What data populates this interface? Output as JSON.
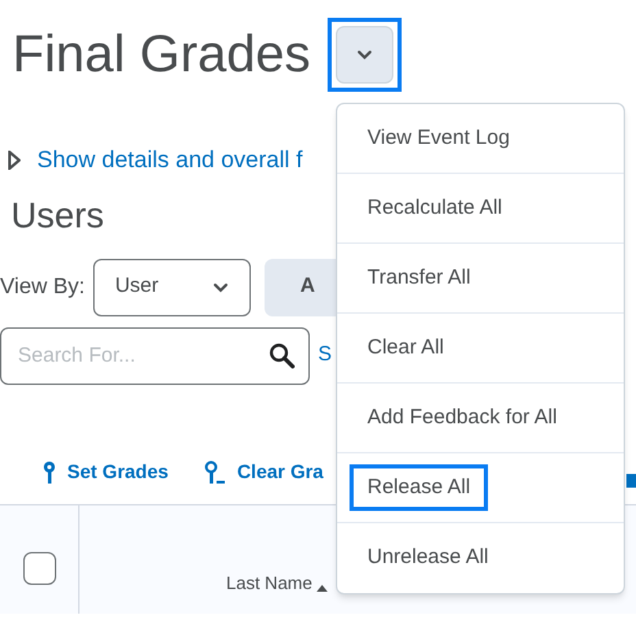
{
  "page_title": "Final Grades",
  "title_menu_button": {
    "highlighted": true
  },
  "details_toggle": {
    "label": "Show details and overall f",
    "expanded": false
  },
  "section_title": "Users",
  "view_by": {
    "label": "View By:",
    "value": "User"
  },
  "apply_button": {
    "label": "A"
  },
  "search": {
    "placeholder": "Search For..."
  },
  "search_options_link": "S",
  "toolbar": [
    {
      "kind": "set",
      "label": "Set Grades"
    },
    {
      "kind": "clear",
      "label": "Clear Gra"
    }
  ],
  "table": {
    "select_all_checked": false,
    "columns": [
      {
        "label": "Last Name",
        "sorted": true
      }
    ]
  },
  "menu": [
    {
      "label": "View Event Log",
      "highlighted": false
    },
    {
      "label": "Recalculate All",
      "highlighted": false
    },
    {
      "label": "Transfer All",
      "highlighted": false
    },
    {
      "label": "Clear All",
      "highlighted": false
    },
    {
      "label": "Add Feedback for All",
      "highlighted": false
    },
    {
      "label": "Release All",
      "highlighted": true
    },
    {
      "label": "Unrelease All",
      "highlighted": false
    }
  ]
}
